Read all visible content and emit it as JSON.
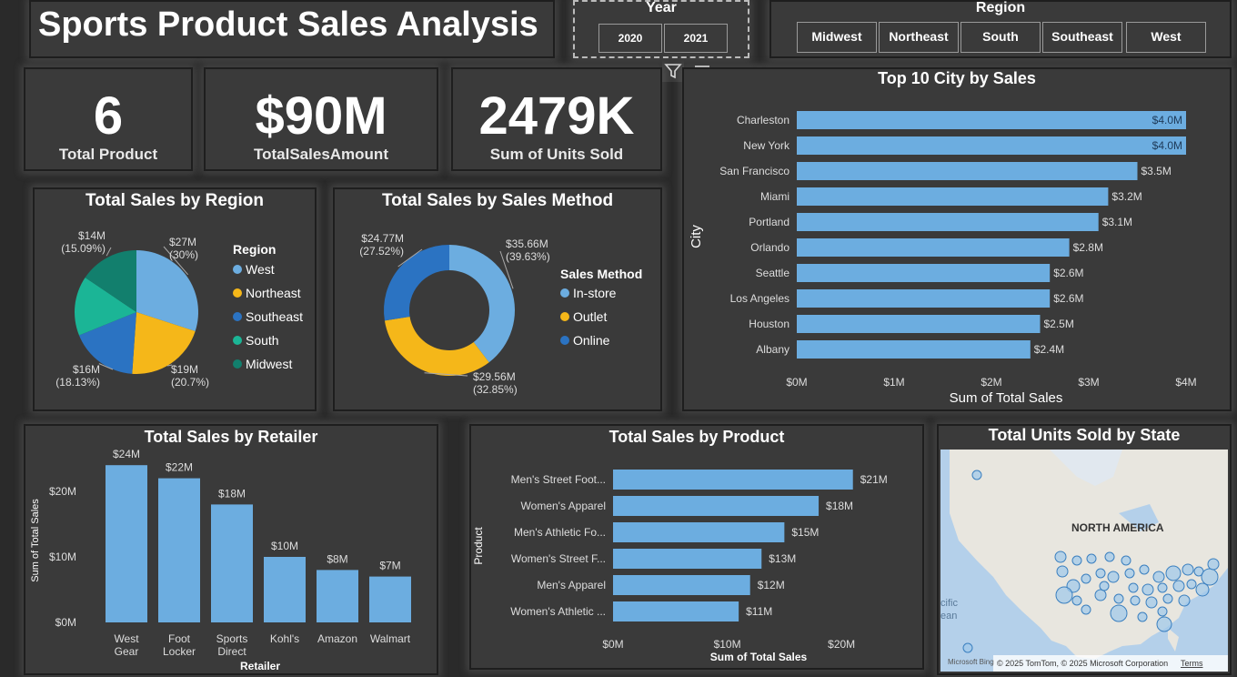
{
  "header": {
    "title": "Sports Product Sales Analysis"
  },
  "year_slicer": {
    "title": "Year",
    "options": [
      "2020",
      "2021"
    ]
  },
  "region_slicer": {
    "title": "Region",
    "options": [
      "Midwest",
      "Northeast",
      "South",
      "Southeast",
      "West"
    ]
  },
  "kpis": [
    {
      "value": "6",
      "label": "Total Product"
    },
    {
      "value": "$90M",
      "label": "TotalSalesAmount"
    },
    {
      "value": "2479K",
      "label": "Sum of Units Sold"
    }
  ],
  "colors": {
    "blue_light": "#6cade0",
    "yellow": "#f5b719",
    "blue_dark": "#2b73c2",
    "teal": "#1bb596",
    "dark_teal": "#127f6d",
    "bar": "#6cade0"
  },
  "chart_data": [
    {
      "id": "region_pie",
      "type": "pie",
      "title": "Total Sales by Region",
      "legend_title": "Region",
      "categories": [
        "West",
        "Northeast",
        "Southeast",
        "South",
        "Midwest"
      ],
      "values": [
        27,
        19,
        16,
        14,
        14
      ],
      "labels": [
        [
          "$27M",
          "(30%)"
        ],
        [
          "$19M",
          "(20.7%)"
        ],
        [
          "$16M",
          "(18.13%)"
        ],
        [],
        [
          "$14M",
          "(15.09%)"
        ]
      ],
      "legend_placement": "right"
    },
    {
      "id": "method_donut",
      "type": "pie",
      "title": "Total Sales by Sales Method",
      "legend_title": "Sales Method",
      "categories": [
        "In-store",
        "Outlet",
        "Online"
      ],
      "values": [
        35.66,
        29.56,
        24.77
      ],
      "labels": [
        [
          "$35.66M",
          "(39.63%)"
        ],
        [
          "$29.56M",
          "(32.85%)"
        ],
        [
          "$24.77M",
          "(27.52%)"
        ]
      ],
      "legend_placement": "right"
    },
    {
      "id": "city_bar",
      "type": "bar",
      "title": "Top 10 City by Sales",
      "categories": [
        "Charleston",
        "New York",
        "San Francisco",
        "Miami",
        "Portland",
        "Orlando",
        "Seattle",
        "Los Angeles",
        "Houston",
        "Albany"
      ],
      "values": [
        4.0,
        4.0,
        3.5,
        3.2,
        3.1,
        2.8,
        2.6,
        2.6,
        2.5,
        2.4
      ],
      "data_labels": [
        "$4.0M",
        "$4.0M",
        "$3.5M",
        "$3.2M",
        "$3.1M",
        "$2.8M",
        "$2.6M",
        "$2.6M",
        "$2.5M",
        "$2.4M"
      ],
      "xlabel": "Sum of Total Sales",
      "ylabel": "City",
      "xticks": [
        "$0M",
        "$1M",
        "$2M",
        "$3M",
        "$4M"
      ],
      "xlim": [
        0,
        4
      ]
    },
    {
      "id": "retailer_bar",
      "type": "bar",
      "title": "Total Sales by Retailer",
      "categories": [
        [
          "West",
          "Gear"
        ],
        [
          "Foot",
          "Locker"
        ],
        [
          "Sports",
          "Direct"
        ],
        [
          "Kohl's"
        ],
        [
          "Amazon"
        ],
        [
          "Walmart"
        ]
      ],
      "values": [
        24,
        22,
        18,
        10,
        8,
        7
      ],
      "data_labels": [
        "$24M",
        "$22M",
        "$18M",
        "$10M",
        "$8M",
        "$7M"
      ],
      "xlabel": "Retailer",
      "ylabel": "Sum of Total Sales",
      "yticks": [
        "$0M",
        "$10M",
        "$20M"
      ],
      "ylim": [
        0,
        25
      ]
    },
    {
      "id": "product_bar",
      "type": "bar",
      "title": "Total Sales by Product",
      "categories": [
        "Men's Street Foot...",
        "Women's Apparel",
        "Men's Athletic Fo...",
        "Women's Street F...",
        "Men's Apparel",
        "Women's Athletic ..."
      ],
      "values": [
        21,
        18,
        15,
        13,
        12,
        11
      ],
      "data_labels": [
        "$21M",
        "$18M",
        "$15M",
        "$13M",
        "$12M",
        "$11M"
      ],
      "xlabel": "Sum of Total Sales",
      "ylabel": "Product",
      "xticks": [
        "$0M",
        "$10M",
        "$20M"
      ],
      "xlim": [
        0,
        21.5
      ]
    }
  ],
  "map": {
    "title": "Total Units Sold by State",
    "region_label": "NORTH AMERICA",
    "ocean_label_1": "cific",
    "ocean_label_2": "ean",
    "attribution": "© 2025 TomTom, © 2025 Microsoft Corporation",
    "terms": "Terms",
    "brand": "Microsoft Bing"
  }
}
